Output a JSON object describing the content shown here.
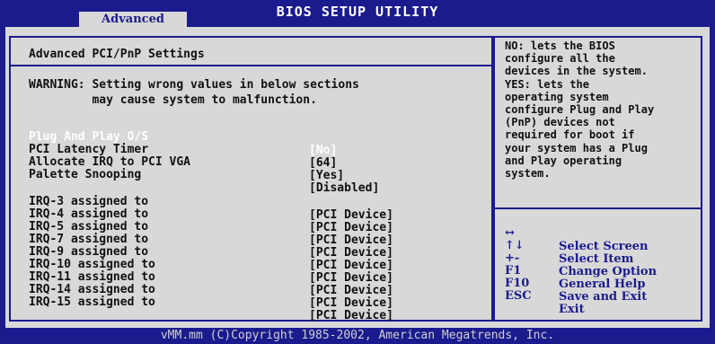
{
  "header": {
    "title": "BIOS SETUP UTILITY",
    "tab": "Advanced"
  },
  "main": {
    "heading": "Advanced PCI/PnP Settings",
    "warning_line1": "WARNING: Setting wrong values in below sections",
    "warning_line2": "         may cause system to malfunction.",
    "settings": [
      {
        "label": "Plug And Play O/S",
        "value": "[No]"
      },
      {
        "label": "PCI Latency Timer",
        "value": "[64]"
      },
      {
        "label": "Allocate IRQ to PCI VGA",
        "value": "[Yes]"
      },
      {
        "label": "Palette Snooping",
        "value": "[Disabled]"
      }
    ],
    "irqs": [
      {
        "label": "IRQ-3 assigned to",
        "value": "[PCI Device]"
      },
      {
        "label": "IRQ-4 assigned to",
        "value": "[PCI Device]"
      },
      {
        "label": "IRQ-5 assigned to",
        "value": "[PCI Device]"
      },
      {
        "label": "IRQ-7 assigned to",
        "value": "[PCI Device]"
      },
      {
        "label": "IRQ-9 assigned to",
        "value": "[PCI Device]"
      },
      {
        "label": "IRQ-10 assigned to",
        "value": "[PCI Device]"
      },
      {
        "label": "IRQ-11 assigned to",
        "value": "[PCI Device]"
      },
      {
        "label": "IRQ-14 assigned to",
        "value": "[PCI Device]"
      },
      {
        "label": "IRQ-15 assigned to",
        "value": "[PCI Device]"
      }
    ]
  },
  "help": {
    "lines": [
      "NO: lets the BIOS",
      "configure all the",
      "devices in the system.",
      "YES: lets the",
      "operating system",
      "configure Plug and Play",
      "(PnP) devices not",
      "required for boot if",
      "your system has a Plug",
      "and Play operating",
      "system."
    ]
  },
  "keys": [
    {
      "key": "↔",
      "desc": "Select Screen"
    },
    {
      "key": "↑↓",
      "desc": "Select Item"
    },
    {
      "key": "+-",
      "desc": "Change Option"
    },
    {
      "key": "F1",
      "desc": "General Help"
    },
    {
      "key": "F10",
      "desc": "Save and Exit"
    },
    {
      "key": "ESC",
      "desc": "Exit"
    }
  ],
  "footer": "vMM.mm (C)Copyright 1985-2002, American Megatrends, Inc."
}
